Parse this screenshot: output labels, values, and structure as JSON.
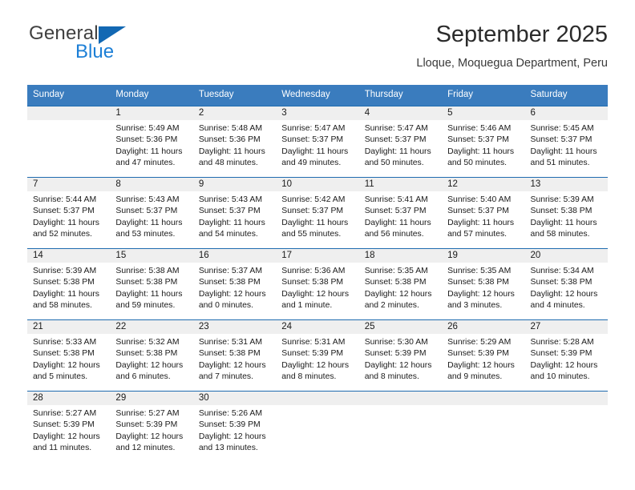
{
  "brand": {
    "name_part1": "General",
    "name_part2": "Blue",
    "colors": {
      "dark": "#404040",
      "blue": "#1c7fd6",
      "triangle": "#1268b3"
    }
  },
  "header": {
    "title": "September 2025",
    "subtitle": "Lloque, Moquegua Department, Peru"
  },
  "calendar": {
    "colors": {
      "header_bg": "#3a7cbe",
      "header_text": "#ffffff",
      "date_band_bg": "#efefef",
      "week_divider": "#1f6cb0"
    },
    "weekdays": [
      "Sunday",
      "Monday",
      "Tuesday",
      "Wednesday",
      "Thursday",
      "Friday",
      "Saturday"
    ],
    "weeks": [
      [
        {
          "day": "",
          "sunrise": "",
          "sunset": "",
          "daylight": ""
        },
        {
          "day": "1",
          "sunrise": "Sunrise: 5:49 AM",
          "sunset": "Sunset: 5:36 PM",
          "daylight": "Daylight: 11 hours and 47 minutes."
        },
        {
          "day": "2",
          "sunrise": "Sunrise: 5:48 AM",
          "sunset": "Sunset: 5:36 PM",
          "daylight": "Daylight: 11 hours and 48 minutes."
        },
        {
          "day": "3",
          "sunrise": "Sunrise: 5:47 AM",
          "sunset": "Sunset: 5:37 PM",
          "daylight": "Daylight: 11 hours and 49 minutes."
        },
        {
          "day": "4",
          "sunrise": "Sunrise: 5:47 AM",
          "sunset": "Sunset: 5:37 PM",
          "daylight": "Daylight: 11 hours and 50 minutes."
        },
        {
          "day": "5",
          "sunrise": "Sunrise: 5:46 AM",
          "sunset": "Sunset: 5:37 PM",
          "daylight": "Daylight: 11 hours and 50 minutes."
        },
        {
          "day": "6",
          "sunrise": "Sunrise: 5:45 AM",
          "sunset": "Sunset: 5:37 PM",
          "daylight": "Daylight: 11 hours and 51 minutes."
        }
      ],
      [
        {
          "day": "7",
          "sunrise": "Sunrise: 5:44 AM",
          "sunset": "Sunset: 5:37 PM",
          "daylight": "Daylight: 11 hours and 52 minutes."
        },
        {
          "day": "8",
          "sunrise": "Sunrise: 5:43 AM",
          "sunset": "Sunset: 5:37 PM",
          "daylight": "Daylight: 11 hours and 53 minutes."
        },
        {
          "day": "9",
          "sunrise": "Sunrise: 5:43 AM",
          "sunset": "Sunset: 5:37 PM",
          "daylight": "Daylight: 11 hours and 54 minutes."
        },
        {
          "day": "10",
          "sunrise": "Sunrise: 5:42 AM",
          "sunset": "Sunset: 5:37 PM",
          "daylight": "Daylight: 11 hours and 55 minutes."
        },
        {
          "day": "11",
          "sunrise": "Sunrise: 5:41 AM",
          "sunset": "Sunset: 5:37 PM",
          "daylight": "Daylight: 11 hours and 56 minutes."
        },
        {
          "day": "12",
          "sunrise": "Sunrise: 5:40 AM",
          "sunset": "Sunset: 5:37 PM",
          "daylight": "Daylight: 11 hours and 57 minutes."
        },
        {
          "day": "13",
          "sunrise": "Sunrise: 5:39 AM",
          "sunset": "Sunset: 5:38 PM",
          "daylight": "Daylight: 11 hours and 58 minutes."
        }
      ],
      [
        {
          "day": "14",
          "sunrise": "Sunrise: 5:39 AM",
          "sunset": "Sunset: 5:38 PM",
          "daylight": "Daylight: 11 hours and 58 minutes."
        },
        {
          "day": "15",
          "sunrise": "Sunrise: 5:38 AM",
          "sunset": "Sunset: 5:38 PM",
          "daylight": "Daylight: 11 hours and 59 minutes."
        },
        {
          "day": "16",
          "sunrise": "Sunrise: 5:37 AM",
          "sunset": "Sunset: 5:38 PM",
          "daylight": "Daylight: 12 hours and 0 minutes."
        },
        {
          "day": "17",
          "sunrise": "Sunrise: 5:36 AM",
          "sunset": "Sunset: 5:38 PM",
          "daylight": "Daylight: 12 hours and 1 minute."
        },
        {
          "day": "18",
          "sunrise": "Sunrise: 5:35 AM",
          "sunset": "Sunset: 5:38 PM",
          "daylight": "Daylight: 12 hours and 2 minutes."
        },
        {
          "day": "19",
          "sunrise": "Sunrise: 5:35 AM",
          "sunset": "Sunset: 5:38 PM",
          "daylight": "Daylight: 12 hours and 3 minutes."
        },
        {
          "day": "20",
          "sunrise": "Sunrise: 5:34 AM",
          "sunset": "Sunset: 5:38 PM",
          "daylight": "Daylight: 12 hours and 4 minutes."
        }
      ],
      [
        {
          "day": "21",
          "sunrise": "Sunrise: 5:33 AM",
          "sunset": "Sunset: 5:38 PM",
          "daylight": "Daylight: 12 hours and 5 minutes."
        },
        {
          "day": "22",
          "sunrise": "Sunrise: 5:32 AM",
          "sunset": "Sunset: 5:38 PM",
          "daylight": "Daylight: 12 hours and 6 minutes."
        },
        {
          "day": "23",
          "sunrise": "Sunrise: 5:31 AM",
          "sunset": "Sunset: 5:38 PM",
          "daylight": "Daylight: 12 hours and 7 minutes."
        },
        {
          "day": "24",
          "sunrise": "Sunrise: 5:31 AM",
          "sunset": "Sunset: 5:39 PM",
          "daylight": "Daylight: 12 hours and 8 minutes."
        },
        {
          "day": "25",
          "sunrise": "Sunrise: 5:30 AM",
          "sunset": "Sunset: 5:39 PM",
          "daylight": "Daylight: 12 hours and 8 minutes."
        },
        {
          "day": "26",
          "sunrise": "Sunrise: 5:29 AM",
          "sunset": "Sunset: 5:39 PM",
          "daylight": "Daylight: 12 hours and 9 minutes."
        },
        {
          "day": "27",
          "sunrise": "Sunrise: 5:28 AM",
          "sunset": "Sunset: 5:39 PM",
          "daylight": "Daylight: 12 hours and 10 minutes."
        }
      ],
      [
        {
          "day": "28",
          "sunrise": "Sunrise: 5:27 AM",
          "sunset": "Sunset: 5:39 PM",
          "daylight": "Daylight: 12 hours and 11 minutes."
        },
        {
          "day": "29",
          "sunrise": "Sunrise: 5:27 AM",
          "sunset": "Sunset: 5:39 PM",
          "daylight": "Daylight: 12 hours and 12 minutes."
        },
        {
          "day": "30",
          "sunrise": "Sunrise: 5:26 AM",
          "sunset": "Sunset: 5:39 PM",
          "daylight": "Daylight: 12 hours and 13 minutes."
        },
        {
          "day": "",
          "sunrise": "",
          "sunset": "",
          "daylight": ""
        },
        {
          "day": "",
          "sunrise": "",
          "sunset": "",
          "daylight": ""
        },
        {
          "day": "",
          "sunrise": "",
          "sunset": "",
          "daylight": ""
        },
        {
          "day": "",
          "sunrise": "",
          "sunset": "",
          "daylight": ""
        }
      ]
    ]
  }
}
